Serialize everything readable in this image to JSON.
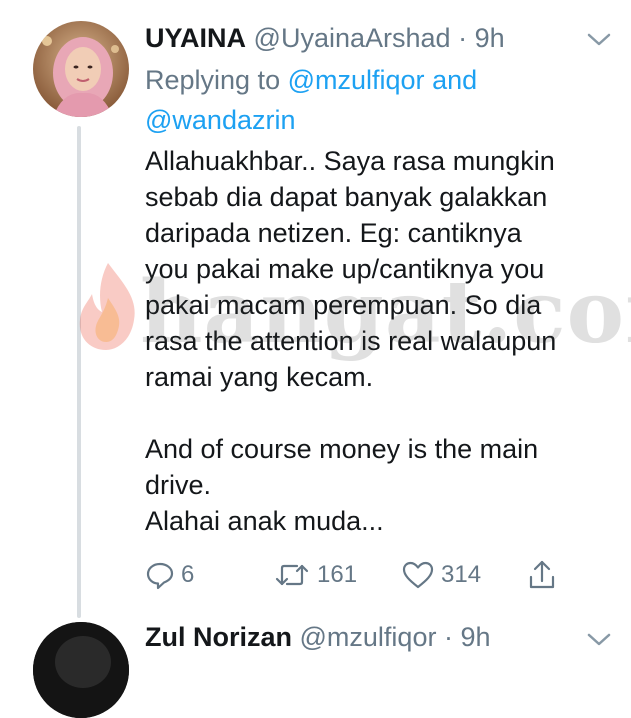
{
  "tweet": {
    "display_name": "UYAINA",
    "handle": "@UyainaArshad",
    "separator": "·",
    "time": "9h",
    "replying_prefix": "Replying to",
    "mention_1": "@mzulfiqor",
    "replying_and": "and",
    "mention_2": "@wandazrin",
    "text_lines": [
      "Allahuakhbar.. Saya rasa mungkin",
      "sebab dia dapat banyak galakkan",
      "daripada netizen. Eg: cantiknya",
      "you pakai make up/cantiknya you",
      "pakai macam perempuan. So dia",
      "rasa the attention is real walaupun",
      "ramai yang kecam.",
      "",
      "And of course money is the main",
      "drive.",
      "Alahai anak muda..."
    ],
    "actions": {
      "reply_count": "6",
      "retweet_count": "161",
      "like_count": "314"
    }
  },
  "next_tweet": {
    "display_name": "Zul Norizan",
    "handle": "@mzulfiqor",
    "separator": "·",
    "time": "9h"
  },
  "watermark": {
    "text": "hangat.com"
  },
  "colors": {
    "text": "#14171a",
    "secondary": "#657786",
    "link": "#1da1f2",
    "thread_line": "#d8dde1",
    "watermark_flame": "#e8432e"
  },
  "icons": [
    "chevron-down-icon",
    "reply-icon",
    "retweet-icon",
    "like-icon",
    "share-icon",
    "flame-icon"
  ]
}
